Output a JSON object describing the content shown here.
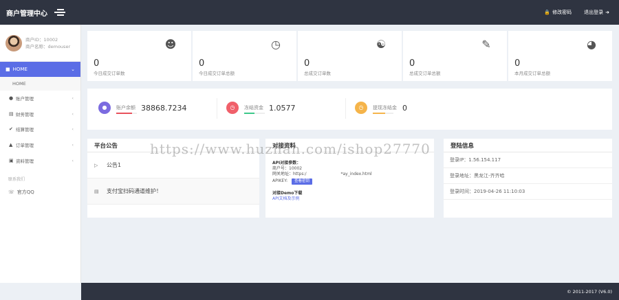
{
  "header": {
    "brand": "商户管理中心",
    "change_password": "修改密码",
    "logout": "退出登录"
  },
  "sidebar": {
    "user_id": "商户ID：10002",
    "user_name": "商户名称：demouser",
    "home": "HOME",
    "home_sub": "HOME",
    "items": [
      {
        "icon": "user-icon",
        "label": "账户管理"
      },
      {
        "icon": "card-icon",
        "label": "财务管理"
      },
      {
        "icon": "check-icon",
        "label": "结算管理"
      },
      {
        "icon": "cart-icon",
        "label": "订单管理"
      },
      {
        "icon": "bank-icon",
        "label": "资料管理"
      }
    ],
    "contact_label": "联系我们",
    "qq_label": "官方QQ"
  },
  "stats": [
    {
      "icon": "user-plus-icon",
      "value": "0",
      "label": "今日成交订单数"
    },
    {
      "icon": "clock-icon",
      "value": "0",
      "label": "今日成交订单总额"
    },
    {
      "icon": "users-icon",
      "value": "0",
      "label": "总成交订单数"
    },
    {
      "icon": "cart-plus-icon",
      "value": "0",
      "label": "总成交订单总额"
    },
    {
      "icon": "pie-chart-icon",
      "value": "0",
      "label": "本月成交订单总额"
    }
  ],
  "balances": [
    {
      "label": "账户余额",
      "value": "38868.7234",
      "color": "#7b6be0",
      "bar_color": "#e8505b",
      "bar_fill": 0.75
    },
    {
      "label": "冻结资金",
      "value": "1.0577",
      "color": "#f0606a",
      "bar_color": "#3cc88a",
      "bar_fill": 0.5
    },
    {
      "label": "提现冻结金",
      "value": "0",
      "color": "#f5b44a",
      "bar_color": "#f5b44a",
      "bar_fill": 0.6
    }
  ],
  "notices": {
    "title": "平台公告",
    "items": [
      {
        "label": "公告1"
      },
      {
        "label": "支付宝扫码通道维护！"
      }
    ]
  },
  "api": {
    "title": "对接资料",
    "info_title": "API对接参数：",
    "merchant": "商户号：10002",
    "gateway": "网关地址：https:/",
    "gateway_tail": "*ay_index.html",
    "apikey_label": "APIKEY:",
    "apikey_btn": "查看密钥",
    "demo_title": "对接Demo下载",
    "demo_link": "API文档及示例"
  },
  "login": {
    "title": "登陆信息",
    "ip": "登录IP：1.56.154.117",
    "location": "登录地址：黑龙江-齐齐哈",
    "time": "登录时间：2019-04-26 11:10:03"
  },
  "watermark": "https://www.huzhan.com/ishop27770",
  "footer": "© 2011-2017 (V6.0)"
}
